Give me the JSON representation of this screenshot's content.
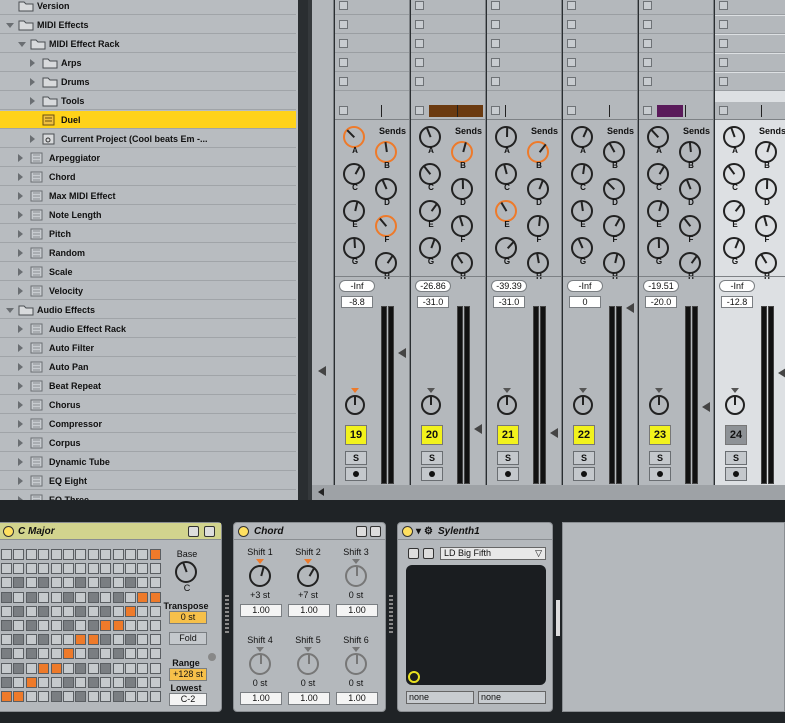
{
  "browser": {
    "rows": [
      {
        "label": "Version",
        "indent": 0,
        "type": "folder",
        "state": "none"
      },
      {
        "label": "MIDI Effects",
        "indent": 0,
        "type": "folder",
        "state": "open"
      },
      {
        "label": "MIDI Effect Rack",
        "indent": 1,
        "type": "folder",
        "state": "open"
      },
      {
        "label": "Arps",
        "indent": 2,
        "type": "folder",
        "state": "closed"
      },
      {
        "label": "Drums",
        "indent": 2,
        "type": "folder",
        "state": "closed"
      },
      {
        "label": "Tools",
        "indent": 2,
        "type": "folder",
        "state": "closed"
      },
      {
        "label": "Duel",
        "indent": 2,
        "type": "preset",
        "state": "none",
        "selected": true
      },
      {
        "label": "Current Project (Cool beats Em -...",
        "indent": 2,
        "type": "project",
        "state": "closed"
      },
      {
        "label": "Arpeggiator",
        "indent": 1,
        "type": "plugin",
        "state": "closed"
      },
      {
        "label": "Chord",
        "indent": 1,
        "type": "plugin",
        "state": "closed"
      },
      {
        "label": "Max MIDI Effect",
        "indent": 1,
        "type": "plugin",
        "state": "closed"
      },
      {
        "label": "Note Length",
        "indent": 1,
        "type": "plugin",
        "state": "closed"
      },
      {
        "label": "Pitch",
        "indent": 1,
        "type": "plugin",
        "state": "closed"
      },
      {
        "label": "Random",
        "indent": 1,
        "type": "plugin",
        "state": "closed"
      },
      {
        "label": "Scale",
        "indent": 1,
        "type": "plugin",
        "state": "closed"
      },
      {
        "label": "Velocity",
        "indent": 1,
        "type": "plugin",
        "state": "closed"
      },
      {
        "label": "Audio Effects",
        "indent": 0,
        "type": "folder",
        "state": "open"
      },
      {
        "label": "Audio Effect Rack",
        "indent": 1,
        "type": "plugin",
        "state": "closed"
      },
      {
        "label": "Auto Filter",
        "indent": 1,
        "type": "plugin",
        "state": "closed"
      },
      {
        "label": "Auto Pan",
        "indent": 1,
        "type": "plugin",
        "state": "closed"
      },
      {
        "label": "Beat Repeat",
        "indent": 1,
        "type": "plugin",
        "state": "closed"
      },
      {
        "label": "Chorus",
        "indent": 1,
        "type": "plugin",
        "state": "closed"
      },
      {
        "label": "Compressor",
        "indent": 1,
        "type": "plugin",
        "state": "closed"
      },
      {
        "label": "Corpus",
        "indent": 1,
        "type": "plugin",
        "state": "closed"
      },
      {
        "label": "Dynamic Tube",
        "indent": 1,
        "type": "plugin",
        "state": "closed"
      },
      {
        "label": "EQ Eight",
        "indent": 1,
        "type": "plugin",
        "state": "closed"
      },
      {
        "label": "EQ Three",
        "indent": 1,
        "type": "plugin",
        "state": "closed"
      }
    ]
  },
  "mixer": {
    "sends_label": "Sends",
    "send_letters": [
      "A",
      "B",
      "C",
      "D",
      "E",
      "F",
      "G",
      "H"
    ],
    "solo_label": "S",
    "channels": [
      {
        "number": "19",
        "volume": "-Inf",
        "peak": "-8.8",
        "orange_sends": [
          "A",
          "B",
          "F"
        ],
        "clip_color": "",
        "light": false
      },
      {
        "number": "20",
        "volume": "-26.86",
        "peak": "-31.0",
        "orange_sends": [
          "B"
        ],
        "clip_color": "#6b3a10",
        "light": false
      },
      {
        "number": "21",
        "volume": "-39.39",
        "peak": "-31.0",
        "orange_sends": [
          "B",
          "E"
        ],
        "clip_color": "",
        "light": false
      },
      {
        "number": "22",
        "volume": "-Inf",
        "peak": "0",
        "orange_sends": [],
        "clip_color": "",
        "light": false
      },
      {
        "number": "23",
        "volume": "-19.51",
        "peak": "-20.0",
        "orange_sends": [],
        "clip_color": "#5a1a5a",
        "light": false
      },
      {
        "number": "24",
        "volume": "-Inf",
        "peak": "-12.8",
        "orange_sends": [],
        "clip_color": "",
        "light": true
      }
    ]
  },
  "scale_device": {
    "title": "C Major",
    "base_label": "Base",
    "base_value": "C",
    "transpose_label": "Transpose",
    "transpose_value": "0 st",
    "fold_label": "Fold",
    "range_label": "Range",
    "range_value": "+128 st",
    "lowest_label": "Lowest",
    "lowest_value": "C-2"
  },
  "chord_device": {
    "title": "Chord",
    "shifts": [
      {
        "label": "Shift 1",
        "value": "+3 st",
        "velocity": "1.00"
      },
      {
        "label": "Shift 2",
        "value": "+7 st",
        "velocity": "1.00"
      },
      {
        "label": "Shift 3",
        "value": "0 st",
        "velocity": "1.00"
      },
      {
        "label": "Shift 4",
        "value": "0 st",
        "velocity": "1.00"
      },
      {
        "label": "Shift 5",
        "value": "0 st",
        "velocity": "1.00"
      },
      {
        "label": "Shift 6",
        "value": "0 st",
        "velocity": "1.00"
      }
    ]
  },
  "sylenth_device": {
    "title": "Sylenth1",
    "preset": "LD Big Fifth",
    "param_left": "none",
    "param_right": "none"
  },
  "colors": {
    "selected": "#ffd21a",
    "clip_yellow": "#f2f21c",
    "send_orange": "#ee7a2a"
  }
}
